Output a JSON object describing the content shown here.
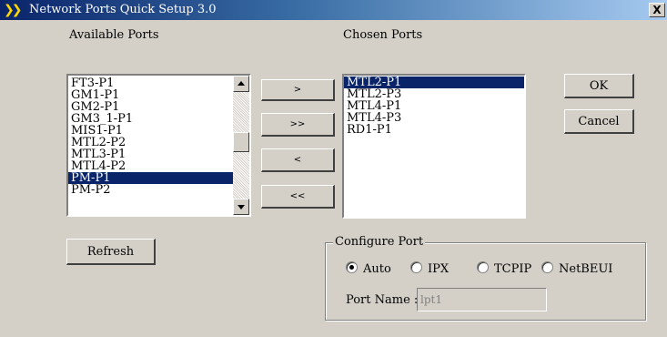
{
  "window": {
    "title": "Network Ports Quick Setup 3.0",
    "icon": "double-chevron-icon",
    "close_label": "X"
  },
  "available": {
    "label": "Available Ports",
    "items": [
      {
        "label": "FT3-P1",
        "selected": false
      },
      {
        "label": "GM1-P1",
        "selected": false
      },
      {
        "label": "GM2-P1",
        "selected": false
      },
      {
        "label": "GM3_1-P1",
        "selected": false
      },
      {
        "label": "MIS1-P1",
        "selected": false
      },
      {
        "label": "MTL2-P2",
        "selected": false
      },
      {
        "label": "MTL3-P1",
        "selected": false
      },
      {
        "label": "MTL4-P2",
        "selected": false
      },
      {
        "label": "PM-P1",
        "selected": true
      },
      {
        "label": "PM-P2",
        "selected": false
      }
    ]
  },
  "chosen": {
    "label": "Chosen Ports",
    "items": [
      {
        "label": "MTL2-P1",
        "selected": true
      },
      {
        "label": "MTL2-P3",
        "selected": false
      },
      {
        "label": "MTL4-P1",
        "selected": false
      },
      {
        "label": "MTL4-P3",
        "selected": false
      },
      {
        "label": "RD1-P1",
        "selected": false
      }
    ]
  },
  "move_buttons": {
    "add_one": ">",
    "add_all": ">>",
    "remove_one": "<",
    "remove_all": "<<"
  },
  "actions": {
    "ok": "OK",
    "cancel": "Cancel",
    "refresh": "Refresh"
  },
  "configure": {
    "title": "Configure Port",
    "protocols": [
      {
        "label": "Auto",
        "checked": true
      },
      {
        "label": "IPX",
        "checked": false
      },
      {
        "label": "TCPIP",
        "checked": false
      },
      {
        "label": "NetBEUI",
        "checked": false
      }
    ],
    "port_name_label": "Port Name :",
    "port_name_value": "lpt1"
  },
  "colors": {
    "dialog_bg": "#d4d0c8",
    "title_bar": "#0a246a",
    "selection": "#0a246a"
  }
}
